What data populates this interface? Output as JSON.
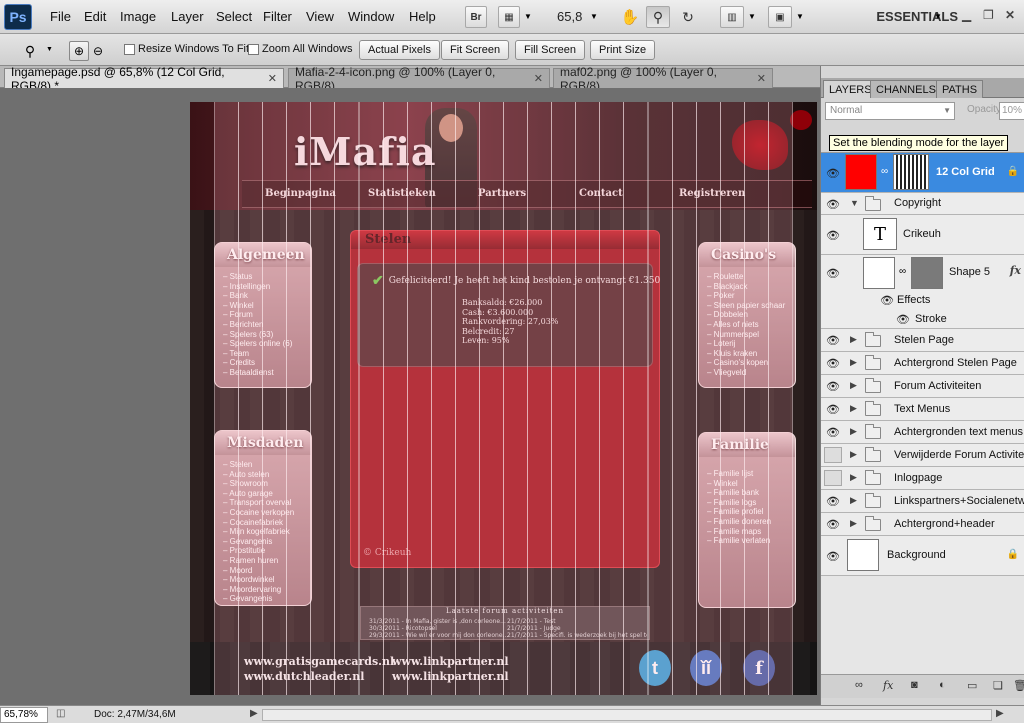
{
  "app": {
    "logo": "Ps"
  },
  "menu": [
    "File",
    "Edit",
    "Image",
    "Layer",
    "Select",
    "Filter",
    "View",
    "Window",
    "Help"
  ],
  "menubar": {
    "bridge": "Br",
    "zoom": "65,8",
    "workspace": "ESSENTIALS"
  },
  "options": {
    "resize_windows": "Resize Windows To Fit",
    "zoom_all": "Zoom All Windows",
    "actual_pixels": "Actual Pixels",
    "fit_screen": "Fit Screen",
    "fill_screen": "Fill Screen",
    "print_size": "Print Size"
  },
  "tabs": [
    {
      "label": "Ingamepage.psd @ 65,8% (12 Col Grid, RGB/8) *"
    },
    {
      "label": "Mafia-2-4-icon.png @ 100% (Layer 0, RGB/8)"
    },
    {
      "label": "maf02.png @ 100% (Layer 0, RGB/8)"
    }
  ],
  "artwork": {
    "logo": "iMafia",
    "nav": [
      "Beginpagina",
      "Statistieken",
      "Partners",
      "Contact",
      "Registreren"
    ],
    "left_top": {
      "title": "Algemeen",
      "items": [
        "Status",
        "Instellingen",
        "Bank",
        "Winkel",
        "Forum",
        "Berichten",
        "Spelers (63)",
        "Spelers online (6)",
        "Team",
        "Credits",
        "Betaaldienst"
      ]
    },
    "left_bottom": {
      "title": "Misdaden",
      "items": [
        "Stelen",
        "Auto stelen",
        "Showroom",
        "Auto garage",
        "Transport overval",
        "Cocaine verkopen",
        "Cocainefabriek",
        "Mijn kogelfabriek",
        "Gevangenis",
        "Prostitutie",
        "Ramen huren",
        "Moord",
        "Moordwinkel",
        "Moordervaring",
        "Gevangenis"
      ]
    },
    "right_top": {
      "title": "Casino's",
      "items": [
        "Roulette",
        "Blackjack",
        "Poker",
        "Steen papier schaar",
        "Dobbelen",
        "Alles of niets",
        "Nummerspel",
        "Loterij",
        "Kluis kraken",
        "Casino's kopen",
        "Vliegveld"
      ]
    },
    "right_bottom": {
      "title": "Familie",
      "items": [
        "Familie lijst",
        "Winkel",
        "Familie bank",
        "Familie logs",
        "Familie profiel",
        "Familie doneren",
        "Familie maps",
        "Familie verlaten"
      ]
    },
    "center": {
      "title": "Stelen",
      "message": "Gefeliciteerd! Je heeft het kind bestolen je ontvangt €1.350",
      "stats": [
        "Banksaldo: €26.000",
        "Cash: €3.600.000",
        "Rankvordering: 27,03%",
        "Belcredit: 27",
        "Leven: 95%"
      ],
      "credit": "© Crikeuh"
    },
    "activity": {
      "title": "Laatste forum activiteiten",
      "rows": [
        {
          "left": "31/3/2011 - In Mafia, gister is ,don corleone...",
          "right": "21/7/2011 - Test"
        },
        {
          "left": "30/3/2011 - Ricotopsel",
          "right": "21/7/2011 - Judge"
        },
        {
          "left": "29/3/2011 - Wie wil er voor mij don corleone...",
          "right": "21/7/2011 - Specifi. is wederzoek bij het spel tei..."
        }
      ]
    },
    "footer": {
      "links": [
        "www.gratisgamecards.nl",
        "www.dutchleader.nl",
        "www.linkpartner.nl",
        "www.linkpartner.nl"
      ]
    },
    "grid_columns": 12
  },
  "layers_panel": {
    "tabs": [
      "LAYERS",
      "CHANNELS",
      "PATHS"
    ],
    "blend_mode": "Normal",
    "opacity_label": "Opacity:",
    "opacity": "10%",
    "tooltip": "Set the blending mode for the layer",
    "layers": [
      {
        "name": "12 Col Grid",
        "type": "layer",
        "visible": true,
        "selected": true
      },
      {
        "name": "Copyright",
        "type": "group",
        "visible": true,
        "expanded": true
      },
      {
        "name": "Crikeuh",
        "type": "text",
        "visible": true
      },
      {
        "name": "Shape 5",
        "type": "shape",
        "visible": true
      },
      {
        "name": "Effects",
        "type": "effects",
        "visible": true
      },
      {
        "name": "Stroke",
        "type": "effect",
        "visible": true
      },
      {
        "name": "Stelen Page",
        "type": "group",
        "visible": true
      },
      {
        "name": "Achtergrond Stelen Page",
        "type": "group",
        "visible": true
      },
      {
        "name": "Forum Activiteiten",
        "type": "group",
        "visible": true
      },
      {
        "name": "Text Menus",
        "type": "group",
        "visible": true
      },
      {
        "name": "Achtergronden text menus",
        "type": "group",
        "visible": true
      },
      {
        "name": "Verwijderde Forum Activiteiten",
        "type": "group",
        "visible": false
      },
      {
        "name": "Inlogpage",
        "type": "group",
        "visible": false
      },
      {
        "name": "Linkspartners+Socialenetwerken",
        "type": "group",
        "visible": true
      },
      {
        "name": "Achtergrond+header",
        "type": "group",
        "visible": true
      },
      {
        "name": "Background",
        "type": "background",
        "visible": true
      }
    ]
  },
  "status": {
    "zoom": "65,78%",
    "doc": "Doc: 2,47M/34,6M"
  },
  "colors": {
    "accent": "#3a8ae0",
    "panel": "#a0111a",
    "swatch": "#ff0000"
  }
}
